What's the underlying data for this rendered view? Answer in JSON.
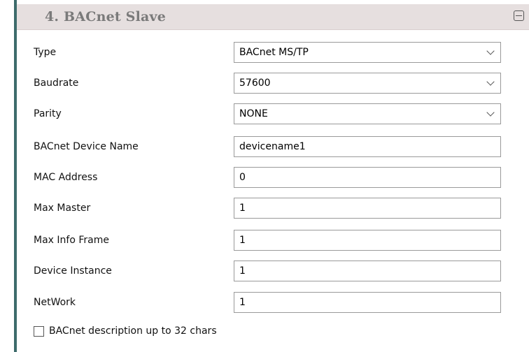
{
  "section": {
    "title": "4. BACnet Slave",
    "collapse_icon": "minus-square-icon"
  },
  "fields": [
    {
      "label": "Type",
      "kind": "select",
      "value": "BACnet MS/TP"
    },
    {
      "label": "Baudrate",
      "kind": "select",
      "value": "57600"
    },
    {
      "label": "Parity",
      "kind": "select",
      "value": "NONE"
    },
    {
      "label": "BACnet Device Name",
      "kind": "input",
      "value": "devicename1"
    },
    {
      "label": "MAC Address",
      "kind": "input",
      "value": "0"
    },
    {
      "label": "Max Master",
      "kind": "input",
      "value": "1"
    },
    {
      "label": "Max Info Frame",
      "kind": "input",
      "value": "1"
    },
    {
      "label": "Device Instance",
      "kind": "input",
      "value": "1"
    },
    {
      "label": "NetWork",
      "kind": "input",
      "value": "1"
    }
  ],
  "checkbox": {
    "label": "BACnet description up to 32 chars",
    "checked": false
  }
}
